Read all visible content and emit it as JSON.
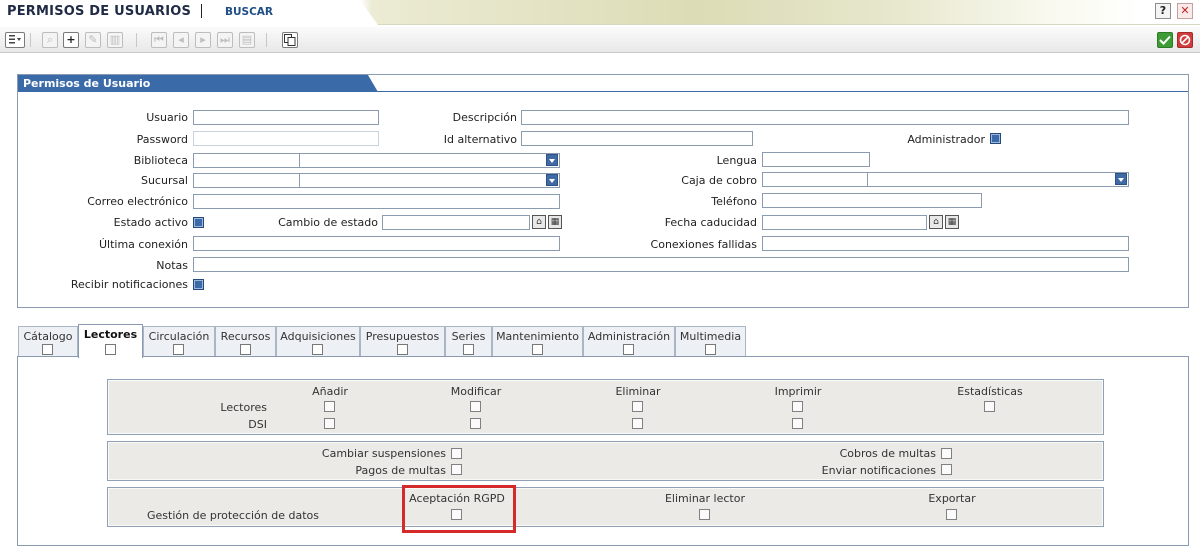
{
  "header": {
    "app_title": "PERMISOS DE USUARIOS",
    "search_link": "BUSCAR",
    "help_label": "?",
    "close_label": "✕"
  },
  "toolbar": {
    "menu_icon": "list-icon",
    "add_label": "+",
    "add_icon": "plus-icon",
    "ok_icon": "check-icon",
    "cancel_icon": "cancel-icon"
  },
  "panel": {
    "title": "Permisos de Usuario",
    "labels": {
      "usuario": "Usuario",
      "descripcion": "Descripción",
      "password": "Password",
      "id_alternativo": "Id alternativo",
      "administrador": "Administrador",
      "biblioteca": "Biblioteca",
      "lengua": "Lengua",
      "sucursal": "Sucursal",
      "caja_cobro": "Caja de cobro",
      "correo": "Correo electrónico",
      "telefono": "Teléfono",
      "estado_activo": "Estado activo",
      "cambio_estado": "Cambio de estado",
      "fecha_caducidad": "Fecha caducidad",
      "ultima_conexion": "Última conexión",
      "conexiones_fallidas": "Conexiones fallidas",
      "notas": "Notas",
      "recibir_notificaciones": "Recibir notificaciones"
    },
    "values": {
      "usuario": "",
      "descripcion": "",
      "password": "",
      "id_alternativo": "",
      "biblioteca_code": "",
      "biblioteca_name": "",
      "lengua": "",
      "sucursal_code": "",
      "sucursal_name": "",
      "caja_code": "",
      "caja_name": "",
      "correo": "",
      "telefono": "",
      "cambio_estado": "",
      "fecha_caducidad": "",
      "ultima_conexion": "",
      "conexiones_fallidas": "",
      "notas": ""
    },
    "checks": {
      "administrador": true,
      "estado_activo": true,
      "recibir_notificaciones": true
    }
  },
  "tabs": [
    {
      "label": "Cátalogo",
      "active": false
    },
    {
      "label": "Lectores",
      "active": true
    },
    {
      "label": "Circulación",
      "active": false
    },
    {
      "label": "Recursos",
      "active": false
    },
    {
      "label": "Adquisiciones",
      "active": false
    },
    {
      "label": "Presupuestos",
      "active": false
    },
    {
      "label": "Series",
      "active": false
    },
    {
      "label": "Mantenimiento",
      "active": false
    },
    {
      "label": "Administración",
      "active": false
    },
    {
      "label": "Multimedia",
      "active": false
    }
  ],
  "permissions": {
    "columns": [
      "Añadir",
      "Modificar",
      "Eliminar",
      "Imprimir",
      "Estadísticas"
    ],
    "rows": [
      "Lectores",
      "DSI"
    ],
    "sanctions": {
      "cambiar_suspensiones": "Cambiar suspensiones",
      "pagos_multas": "Pagos de multas",
      "cobros_multas": "Cobros de multas",
      "enviar_notificaciones": "Enviar notificaciones"
    },
    "gdpr": {
      "row_label": "Gestión de protección de datos",
      "aceptacion": "Aceptación RGPD",
      "eliminar_lector": "Eliminar lector",
      "exportar": "Exportar"
    }
  }
}
